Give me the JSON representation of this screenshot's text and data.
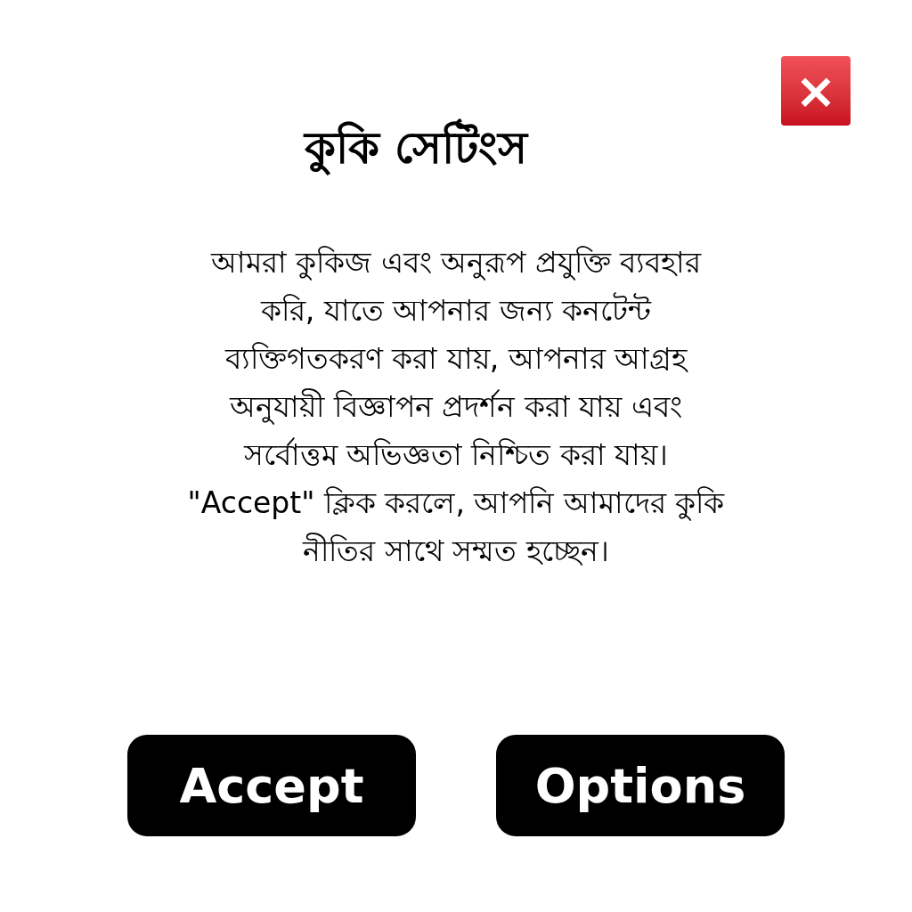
{
  "dialog": {
    "close_button": {
      "label": "×"
    },
    "title": "কুকি সেটিংস",
    "message_lines": [
      "আমরা কুকিজ এবং অনুরূপ প্রযুক্তি ব্যবহার",
      "করি, যাতে আপনার জন্য কনটেন্ট",
      "ব্যক্তিগতকরণ করা যায়, আপনার আগ্রহ",
      "অনুযায়ী বিজ্ঞাপন প্রদর্শন করা যায় এবং",
      "সর্বোত্তম অভিজ্ঞতা নিশ্চিত করা যায়।",
      "\"Accept\" ক্লিক করলে, আপনি আমাদের কুকি",
      "নীতির সাথে সম্মত হচ্ছেন।"
    ],
    "buttons": [
      "Accept",
      "Options"
    ]
  }
}
